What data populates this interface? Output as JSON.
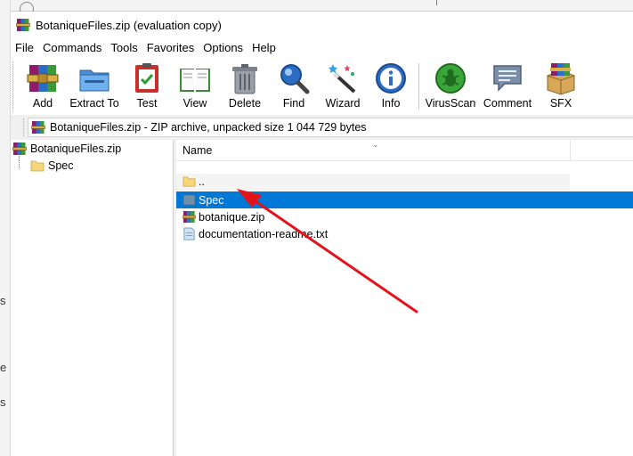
{
  "window": {
    "title": "BotaniqueFiles.zip (evaluation copy)",
    "app_icon": "winrar-icon"
  },
  "menu": {
    "items": [
      "File",
      "Commands",
      "Tools",
      "Favorites",
      "Options",
      "Help"
    ]
  },
  "toolbar": {
    "buttons": [
      {
        "label": "Add",
        "icon": "add-archive-icon"
      },
      {
        "label": "Extract To",
        "icon": "extract-to-icon"
      },
      {
        "label": "Test",
        "icon": "test-clipboard-icon"
      },
      {
        "label": "View",
        "icon": "view-book-icon"
      },
      {
        "label": "Delete",
        "icon": "trash-icon"
      },
      {
        "label": "Find",
        "icon": "magnifier-icon"
      },
      {
        "label": "Wizard",
        "icon": "wizard-wand-icon"
      },
      {
        "label": "Info",
        "icon": "info-icon"
      },
      {
        "label": "VirusScan",
        "icon": "virus-scan-icon"
      },
      {
        "label": "Comment",
        "icon": "comment-icon"
      },
      {
        "label": "SFX",
        "icon": "sfx-box-icon"
      }
    ]
  },
  "address": {
    "text": "BotaniqueFiles.zip - ZIP archive, unpacked size 1 044 729 bytes"
  },
  "tree": {
    "root": "BotaniqueFiles.zip",
    "children": [
      "Spec"
    ]
  },
  "filelist": {
    "column_name": "Name",
    "rows": [
      {
        "name": "..",
        "icon": "folder-up-icon"
      },
      {
        "name": "Spec",
        "icon": "folder-icon",
        "selected": true
      },
      {
        "name": "botanique.zip",
        "icon": "zip-archive-icon"
      },
      {
        "name": "documentation-readme.txt",
        "icon": "text-file-icon"
      }
    ]
  },
  "colors": {
    "selection": "#0078d7",
    "annotation_arrow": "#e3131b"
  }
}
